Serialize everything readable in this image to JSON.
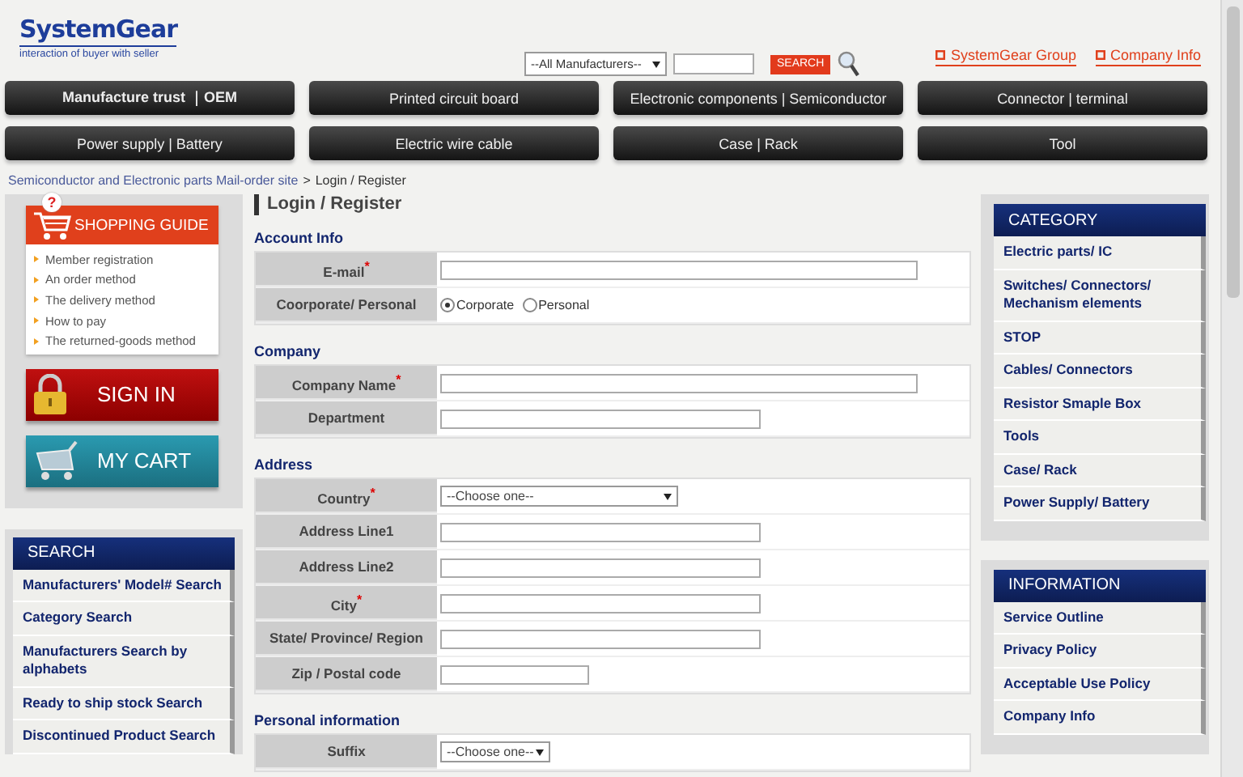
{
  "header": {
    "logo": "SystemGear",
    "tagline": "interaction of buyer with seller",
    "manufacturer_select": "--All Manufacturers--",
    "search_button": "SEARCH",
    "links": [
      "SystemGear Group",
      "Company Info"
    ]
  },
  "nav": [
    {
      "label": "Manufacture trust ｜OEM",
      "bold": true
    },
    {
      "label": "Printed circuit board",
      "bold": false
    },
    {
      "label": "Electronic components | Semiconductor",
      "bold": false
    },
    {
      "label": "Connector | terminal",
      "bold": false
    },
    {
      "label": "Power supply | Battery",
      "bold": false
    },
    {
      "label": "Electric wire cable",
      "bold": false
    },
    {
      "label": "Case | Rack",
      "bold": false
    },
    {
      "label": "Tool",
      "bold": false
    }
  ],
  "breadcrumb": {
    "link": "Semiconductor and Electronic parts Mail-order site",
    "separator": ">",
    "current": "Login / Register"
  },
  "page_title": "Login / Register",
  "shopping_guide": {
    "badge": "?",
    "title": "SHOPPING GUIDE",
    "items": [
      "Member registration",
      "An order method",
      "The delivery method",
      "How to pay",
      "The returned-goods method"
    ]
  },
  "sign_in": "SIGN IN",
  "my_cart": "MY CART",
  "search_panel": {
    "title": "SEARCH",
    "items": [
      "Manufacturers' Model# Search",
      "Category Search",
      "Manufacturers Search by alphabets",
      "Ready to ship stock Search",
      "Discontinued Product Search"
    ]
  },
  "sections": [
    {
      "title": "Account Info",
      "rows": [
        {
          "label": "E-mail$^{*}$",
          "kind": "widetext"
        },
        {
          "label": "Coorporate/ Personal",
          "kind": "radio",
          "options": [
            {
              "label": "Corporate",
              "selected": true
            },
            {
              "label": "Personal",
              "selected": false
            }
          ]
        }
      ]
    },
    {
      "title": "Company",
      "rows": [
        {
          "label": "Company Name$^{*}$",
          "kind": "widetext"
        },
        {
          "label": "Department",
          "kind": "text"
        }
      ]
    },
    {
      "title": "Address",
      "rows": [
        {
          "label": "Country$^{*}$",
          "kind": "wideselect",
          "value": "--Choose one--"
        },
        {
          "label": "Address Line1",
          "kind": "text"
        },
        {
          "label": "Address Line2",
          "kind": "text"
        },
        {
          "label": "City$^{*}$",
          "kind": "text"
        },
        {
          "label": "State/ Province/ Region",
          "kind": "text"
        },
        {
          "label": "Zip / Postal code",
          "kind": "shorttext"
        }
      ]
    },
    {
      "title": "Personal information",
      "rows": [
        {
          "label": "Suffix",
          "kind": "select",
          "value": "--Choose one--"
        }
      ]
    }
  ],
  "category": {
    "title": "CATEGORY",
    "items": [
      "Electric parts/ IC",
      "Switches/ Connectors/ Mechanism elements",
      "STOP",
      "Cables/ Connectors",
      "Resistor Smaple Box",
      "Tools",
      "Case/ Rack",
      "Power Supply/ Battery"
    ]
  },
  "information": {
    "title": "INFORMATION",
    "items": [
      "Service Outline",
      "Privacy Policy",
      "Acceptable Use Policy",
      "Company Info"
    ]
  }
}
